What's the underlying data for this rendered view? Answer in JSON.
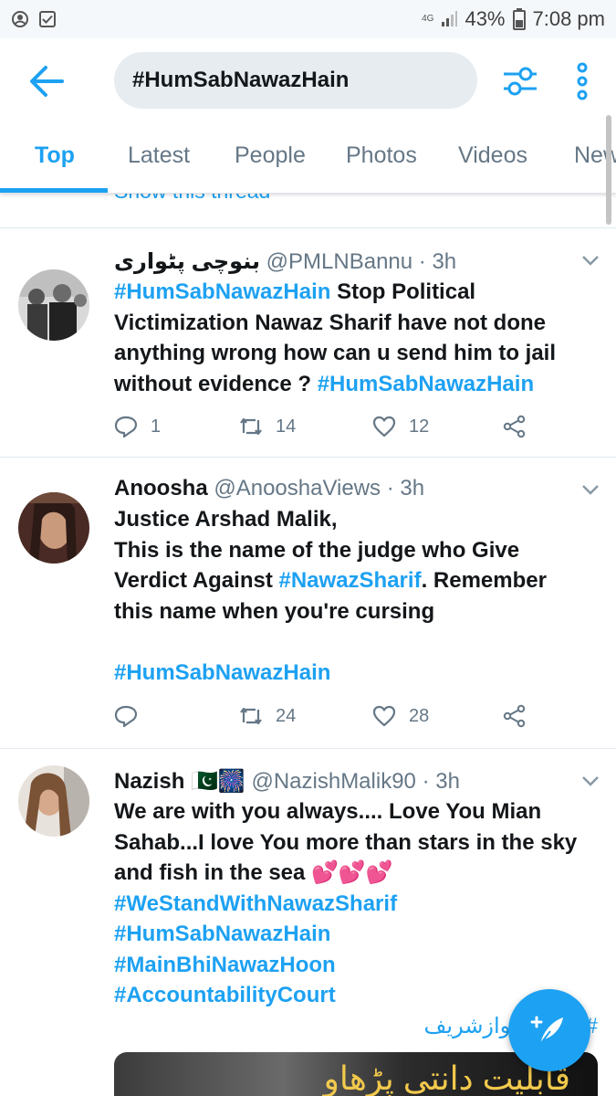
{
  "status_bar": {
    "network": "4G",
    "battery": "43%",
    "time": "7:08 pm"
  },
  "header": {
    "search_value": "#HumSabNawazHain"
  },
  "tabs": [
    "Top",
    "Latest",
    "People",
    "Photos",
    "Videos",
    "News"
  ],
  "tabs_active": "Top",
  "feed": {
    "show_thread": "Show this thread",
    "tweets": [
      {
        "name": "بنوچی پٹواری",
        "handle": "@PMLNBannu",
        "time": "· 3h",
        "lines": [
          [
            {
              "t": "#HumSabNawazHain",
              "h": true
            },
            {
              "t": " Stop Political"
            }
          ],
          [
            {
              "t": "Victimization Nawaz Sharif have not done"
            }
          ],
          [
            {
              "t": "anything wrong how can u send him to jail"
            }
          ],
          [
            {
              "t": "without evidence ? "
            },
            {
              "t": "#HumSabNawazHain",
              "h": true
            }
          ]
        ],
        "replies": "1",
        "retweets": "14",
        "likes": "12"
      },
      {
        "name": "Anoosha",
        "handle": "@AnooshaViews",
        "time": "· 3h",
        "lines": [
          [
            {
              "t": "Justice Arshad Malik,"
            }
          ],
          [
            {
              "t": "This is the name of the judge who Give"
            }
          ],
          [
            {
              "t": "Verdict Against "
            },
            {
              "t": "#NawazSharif",
              "h": true
            },
            {
              "t": ". Remember"
            }
          ],
          [
            {
              "t": "this name when you're cursing"
            }
          ],
          [
            {
              "t": ""
            }
          ],
          [
            {
              "t": "#HumSabNawazHain",
              "h": true
            }
          ]
        ],
        "replies": "",
        "retweets": "24",
        "likes": "28"
      },
      {
        "name": "Nazish 🇵🇰🎆",
        "handle": "@NazishMalik90",
        "time": "· 3h",
        "lines": [
          [
            {
              "t": "We are with you always.... Love You Mian"
            }
          ],
          [
            {
              "t": "Sahab...I love You more than stars in the sky"
            }
          ],
          [
            {
              "t": "and fish in the sea 💕💕💕"
            }
          ],
          [
            {
              "t": "#WeStandWithNawazSharif",
              "h": true
            }
          ],
          [
            {
              "t": "#HumSabNawazHain",
              "h": true
            }
          ],
          [
            {
              "t": "#MainBhiNawazHoon",
              "h": true
            }
          ],
          [
            {
              "t": "#AccountabilityCourt",
              "h": true
            }
          ]
        ],
        "urdu_tag": "#فیصلہ_نوازشریف",
        "media_text": "قابلیت دانتی پڑھاو"
      }
    ]
  }
}
